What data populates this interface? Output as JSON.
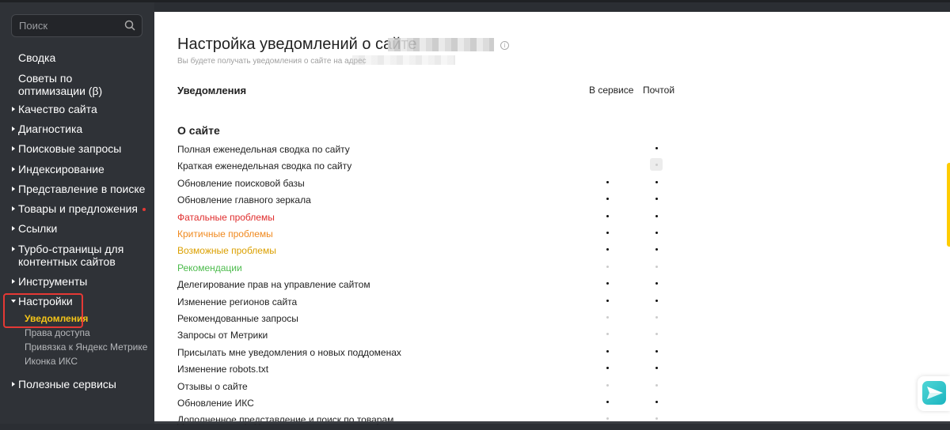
{
  "sidebar": {
    "search_placeholder": "Поиск",
    "items": [
      "Сводка",
      "Советы по оптимизации (β)",
      "Качество сайта",
      "Диагностика",
      "Поисковые запросы",
      "Индексирование",
      "Представление в поиске",
      "Товары и предложения",
      "Ссылки",
      "Турбо-страницы для контентных сайтов",
      "Инструменты",
      "Настройки",
      "Полезные сервисы"
    ],
    "settings_sub": [
      "Уведомления",
      "Права доступа",
      "Привязка к Яндекс Метрике",
      "Иконка ИКС"
    ]
  },
  "main": {
    "title": "Настройка уведомлений о сайте",
    "subtitle": "Вы будете получать уведомления о сайте на адрес",
    "header_label": "Уведомления",
    "col_service": "В сервисе",
    "col_email": "Почтой",
    "section": "О сайте",
    "rows": [
      {
        "label": "Полная еженедельная сводка по сайту",
        "service": "none",
        "email": "on"
      },
      {
        "label": "Краткая еженедельная сводка по сайту",
        "service": "none",
        "email": "off-box"
      },
      {
        "label": "Обновление поисковой базы",
        "service": "on",
        "email": "on"
      },
      {
        "label": "Обновление главного зеркала",
        "service": "on",
        "email": "on"
      },
      {
        "label": "Фатальные проблемы",
        "service": "on",
        "email": "on",
        "color": "#e02d2d"
      },
      {
        "label": "Критичные проблемы",
        "service": "on",
        "email": "on",
        "color": "#f0891e"
      },
      {
        "label": "Возможные проблемы",
        "service": "on",
        "email": "on",
        "color": "#dba000"
      },
      {
        "label": "Рекомендации",
        "service": "off",
        "email": "off",
        "color": "#4cbb4c"
      },
      {
        "label": "Делегирование прав на управление сайтом",
        "service": "on",
        "email": "on"
      },
      {
        "label": "Изменение регионов сайта",
        "service": "on",
        "email": "on"
      },
      {
        "label": "Рекомендованные запросы",
        "service": "off",
        "email": "off"
      },
      {
        "label": "Запросы от Метрики",
        "service": "off",
        "email": "off"
      },
      {
        "label": "Присылать мне уведомления о новых поддоменах",
        "service": "on",
        "email": "on"
      },
      {
        "label": "Изменение robots.txt",
        "service": "on",
        "email": "on"
      },
      {
        "label": "Отзывы о сайте",
        "service": "off",
        "email": "off"
      },
      {
        "label": "Обновление ИКС",
        "service": "on",
        "email": "on"
      },
      {
        "label": "Дополненное представление и поиск по товарам",
        "service": "off",
        "email": "off"
      }
    ]
  }
}
